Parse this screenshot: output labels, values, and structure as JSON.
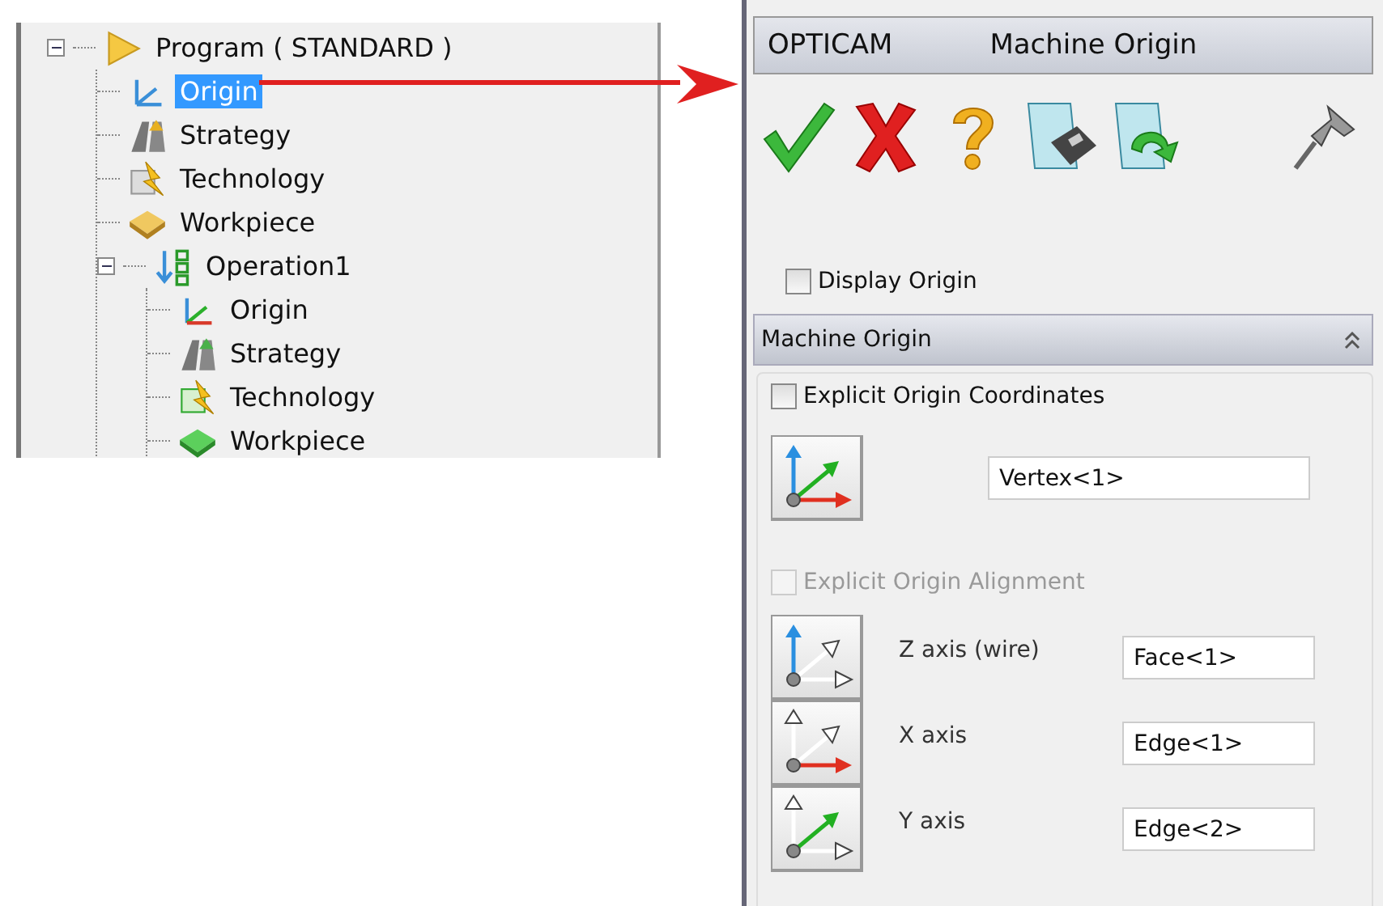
{
  "tree": [
    {
      "label": "Program ( STANDARD )",
      "kind": "program",
      "expanded": true,
      "selected": false,
      "children": [
        {
          "label": "Origin",
          "kind": "origin",
          "selected": true
        },
        {
          "label": "Strategy",
          "kind": "strategy",
          "selected": false
        },
        {
          "label": "Technology",
          "kind": "technology",
          "selected": false
        },
        {
          "label": "Workpiece",
          "kind": "workpiece",
          "selected": false
        },
        {
          "label": "Operation1",
          "kind": "operation",
          "expanded": true,
          "selected": false,
          "children": [
            {
              "label": "Origin",
              "kind": "origin",
              "selected": false
            },
            {
              "label": "Strategy",
              "kind": "strategy",
              "selected": false
            },
            {
              "label": "Technology",
              "kind": "technology",
              "selected": false
            },
            {
              "label": "Workpiece",
              "kind": "workpiece",
              "selected": false
            }
          ]
        }
      ]
    }
  ],
  "panel": {
    "app_name": "OPTICAM",
    "title": "Machine Origin",
    "display_origin": {
      "label": "Display Origin",
      "checked": false,
      "disabled": false
    },
    "section": {
      "title": "Machine Origin",
      "expanded": true,
      "explicit_coordinates": {
        "label": "Explicit Origin Coordinates",
        "checked": false,
        "disabled": false
      },
      "origin_pick": {
        "kind": "all",
        "value": "Vertex<1>"
      },
      "explicit_alignment": {
        "label": "Explicit Origin Alignment",
        "checked": false,
        "disabled": true
      },
      "axes": [
        {
          "label": "Z axis (wire)",
          "kind": "z",
          "value": "Face<1>"
        },
        {
          "label": "X axis",
          "kind": "x",
          "value": "Edge<1>"
        },
        {
          "label": "Y axis",
          "kind": "y",
          "value": "Edge<2>"
        }
      ]
    }
  }
}
